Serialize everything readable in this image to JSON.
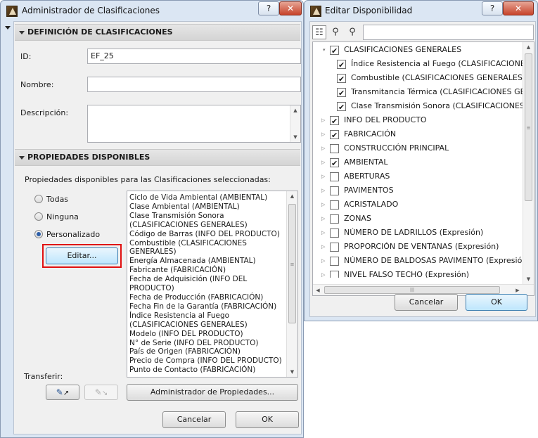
{
  "left_window": {
    "title": "Administrador de Clasificaciones",
    "help_label": "?",
    "close_label": "✕",
    "section_definition": "DEFINICIÓN DE CLASIFICACIONES",
    "id_label": "ID:",
    "id_value": "EF_25",
    "name_label": "Nombre:",
    "name_value": "",
    "description_label": "Descripción:",
    "description_value": "",
    "section_properties": "PROPIEDADES DISPONIBLES",
    "properties_intro": "Propiedades disponibles para las Clasificaciones seleccionadas:",
    "radio_options": [
      {
        "label": "Todas",
        "selected": false
      },
      {
        "label": "Ninguna",
        "selected": false
      },
      {
        "label": "Personalizado",
        "selected": true
      }
    ],
    "edit_button": "Editar...",
    "property_list": [
      "Ciclo de Vida Ambiental (AMBIENTAL)",
      "Clase Ambiental (AMBIENTAL)",
      "Clase Transmisión Sonora",
      "(CLASIFICACIONES GENERALES)",
      "Código de Barras (INFO DEL PRODUCTO)",
      "Combustible (CLASIFICACIONES",
      "GENERALES)",
      "Energía Almacenada (AMBIENTAL)",
      "Fabricante (FABRICACIÓN)",
      "Fecha de Adquisición (INFO DEL",
      "PRODUCTO)",
      "Fecha de Producción (FABRICACIÓN)",
      "Fecha Fin de la Garantía (FABRICACIÓN)",
      "Índice Resistencia al Fuego",
      "(CLASIFICACIONES GENERALES)",
      "Modelo (INFO DEL PRODUCTO)",
      "N° de Serie (INFO DEL PRODUCTO)",
      "País de Origen (FABRICACIÓN)",
      "Precio de Compra (INFO DEL PRODUCTO)",
      "Punto de Contacto (FABRICACIÓN)"
    ],
    "transfer_label": "Transferir:",
    "properties_manager_button": "Administrador de Propiedades...",
    "cancel_button": "Cancelar",
    "ok_button": "OK"
  },
  "right_window": {
    "title": "Editar Disponibilidad",
    "help_label": "?",
    "close_label": "✕",
    "search_value": "",
    "tree": [
      {
        "label": "CLASIFICACIONES GENERALES",
        "checked": true,
        "level": 0,
        "expander": "▾"
      },
      {
        "label": "Índice Resistencia al Fuego (CLASIFICACIONES GENERALES)",
        "checked": true,
        "level": 1,
        "expander": ""
      },
      {
        "label": "Combustible (CLASIFICACIONES GENERALES)",
        "checked": true,
        "level": 1,
        "expander": ""
      },
      {
        "label": "Transmitancia Térmica (CLASIFICACIONES GENERALES)",
        "checked": true,
        "level": 1,
        "expander": ""
      },
      {
        "label": "Clase Transmisión Sonora (CLASIFICACIONES GENERALES)",
        "checked": true,
        "level": 1,
        "expander": ""
      },
      {
        "label": "INFO DEL PRODUCTO",
        "checked": true,
        "level": 0,
        "expander": "▷"
      },
      {
        "label": "FABRICACIÓN",
        "checked": true,
        "level": 0,
        "expander": "▷"
      },
      {
        "label": "CONSTRUCCIÓN PRINCIPAL",
        "checked": false,
        "level": 0,
        "expander": "▷"
      },
      {
        "label": "AMBIENTAL",
        "checked": true,
        "level": 0,
        "expander": "▷"
      },
      {
        "label": "ABERTURAS",
        "checked": false,
        "level": 0,
        "expander": "▷"
      },
      {
        "label": "PAVIMENTOS",
        "checked": false,
        "level": 0,
        "expander": "▷"
      },
      {
        "label": "ACRISTALADO",
        "checked": false,
        "level": 0,
        "expander": "▷"
      },
      {
        "label": "ZONAS",
        "checked": false,
        "level": 0,
        "expander": "▷"
      },
      {
        "label": "NÚMERO DE LADRILLOS (Expresión)",
        "checked": false,
        "level": 0,
        "expander": "▷"
      },
      {
        "label": "PROPORCIÓN DE VENTANAS (Expresión)",
        "checked": false,
        "level": 0,
        "expander": "▷"
      },
      {
        "label": "NÚMERO DE BALDOSAS PAVIMENTO (Expresión)",
        "checked": false,
        "level": 0,
        "expander": "▷"
      },
      {
        "label": "NIVEL FALSO TECHO (Expresión)",
        "checked": false,
        "level": 0,
        "expander": "▷"
      }
    ],
    "cancel_button": "Cancelar",
    "ok_button": "OK"
  },
  "icons": {
    "list_view": "☷",
    "filter": "⚲",
    "search": "⚲"
  }
}
